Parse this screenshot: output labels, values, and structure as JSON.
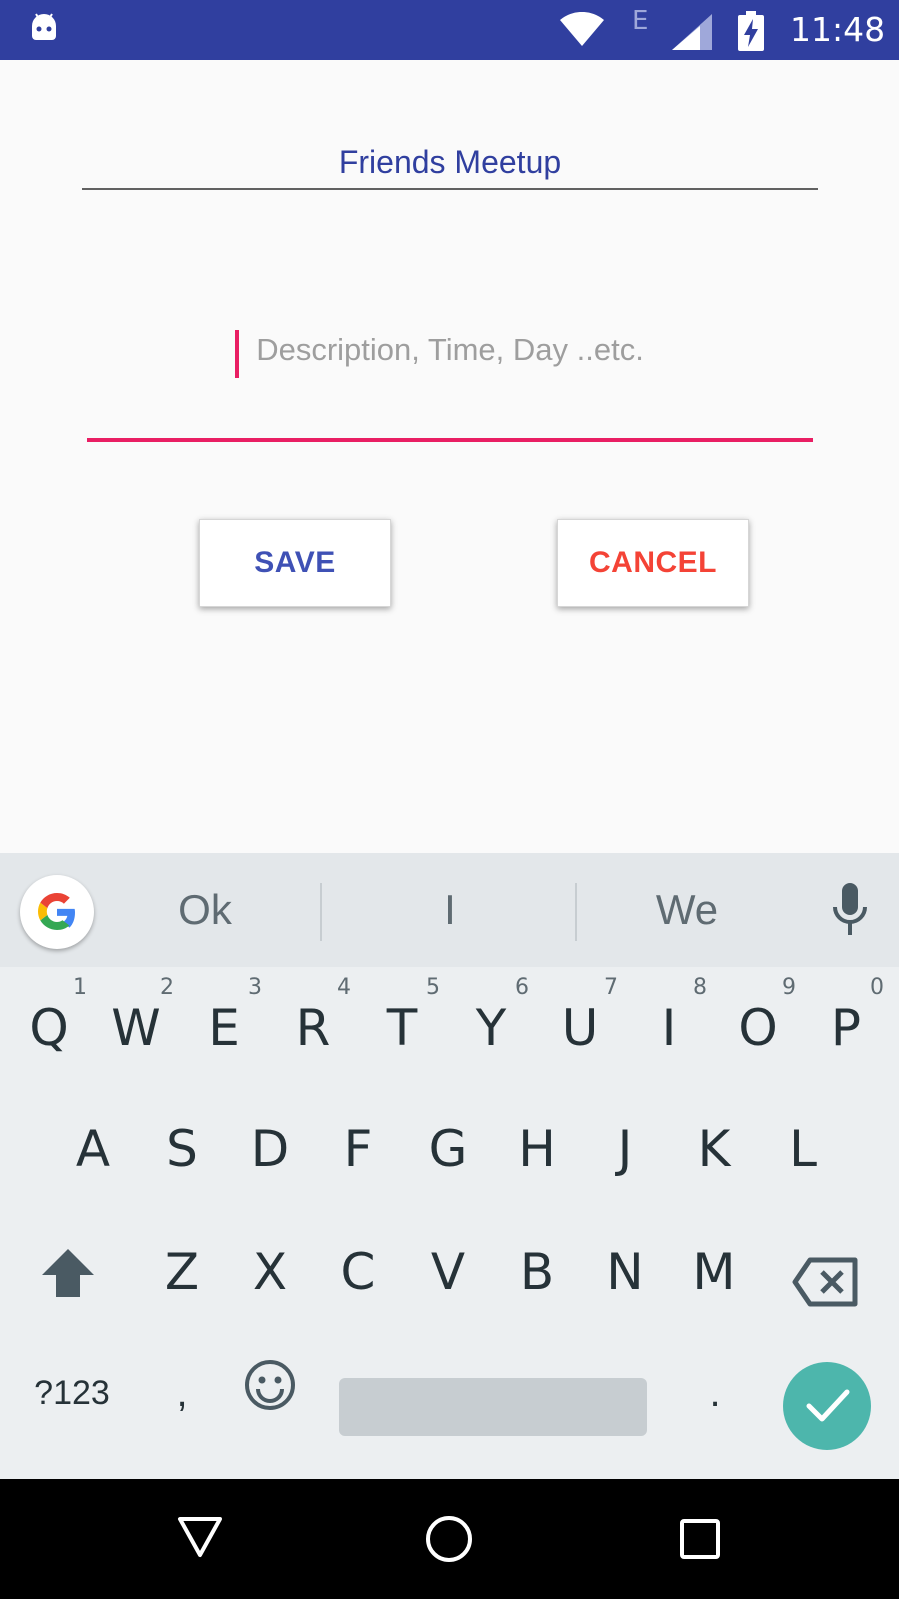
{
  "status_bar": {
    "network_type": "E",
    "time": "11:48",
    "icons": [
      "android-icon",
      "wifi-icon",
      "signal-icon",
      "battery-charging-icon"
    ]
  },
  "form": {
    "title_value": "Friends Meetup",
    "description_placeholder": "Description, Time, Day ..etc.",
    "save_label": "SAVE",
    "cancel_label": "CANCEL"
  },
  "keyboard": {
    "suggestions": [
      "Ok",
      "I",
      "We"
    ],
    "row1": [
      {
        "k": "Q",
        "h": "1"
      },
      {
        "k": "W",
        "h": "2"
      },
      {
        "k": "E",
        "h": "3"
      },
      {
        "k": "R",
        "h": "4"
      },
      {
        "k": "T",
        "h": "5"
      },
      {
        "k": "Y",
        "h": "6"
      },
      {
        "k": "U",
        "h": "7"
      },
      {
        "k": "I",
        "h": "8"
      },
      {
        "k": "O",
        "h": "9"
      },
      {
        "k": "P",
        "h": "0"
      }
    ],
    "row2": [
      "A",
      "S",
      "D",
      "F",
      "G",
      "H",
      "J",
      "K",
      "L"
    ],
    "row3": [
      "Z",
      "X",
      "C",
      "V",
      "B",
      "N",
      "M"
    ],
    "symbols_label": "?123",
    "comma_label": ",",
    "period_label": "."
  },
  "colors": {
    "primary": "#303f9f",
    "accent": "#e91e63",
    "save_text": "#3f51b5",
    "cancel_text": "#f44336",
    "enter_key": "#4db6ac"
  }
}
